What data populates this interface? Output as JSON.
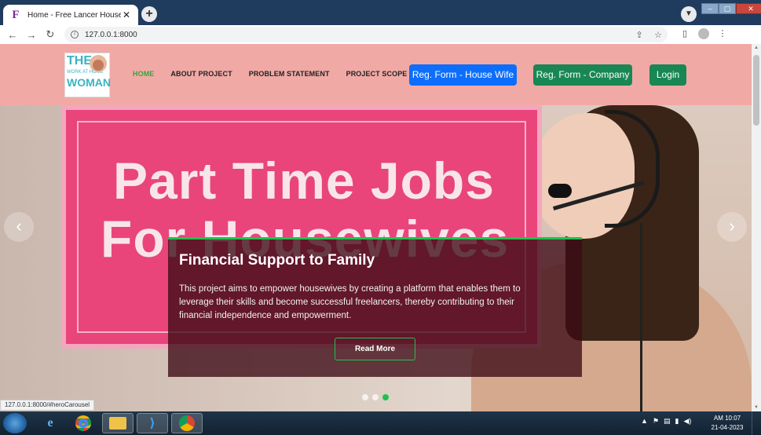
{
  "browser": {
    "tab_title": "Home - Free Lancer House Wife",
    "tab_favicon": "F",
    "url": "127.0.0.1:8000",
    "status_url": "127.0.0.1:8000/#heroCarousel"
  },
  "site": {
    "logo": {
      "line1": "THE",
      "line2": "WORK AT HOME",
      "line3": "WOMAN"
    },
    "menu": [
      {
        "label": "HOME",
        "active": true
      },
      {
        "label": "ABOUT PROJECT",
        "active": false
      },
      {
        "label": "PROBLEM STATEMENT",
        "active": false
      },
      {
        "label": "PROJECT SCOPE",
        "active": false
      }
    ],
    "buttons": {
      "reg_housewife": "Reg. Form - House Wife",
      "reg_company": "Reg. Form - Company",
      "login": "Login"
    },
    "colors": {
      "header_bg": "#f1a9a6",
      "active_menu": "#3aa33f",
      "primary": "#0d6efd",
      "success": "#198754",
      "accent": "#20c150"
    }
  },
  "hero": {
    "banner_line1": "Part Time Jobs",
    "banner_line2": "For Housewives",
    "caption_title": "Financial Support to Family",
    "caption_text": "This project aims to empower housewives by creating a platform that enables them to leverage their skills and become successful freelancers, thereby contributing to their financial independence and empowerment.",
    "read_more": "Read More",
    "slides": 3,
    "active_slide": 3,
    "prev_icon": "chevron-left-icon",
    "next_icon": "chevron-right-icon"
  },
  "taskbar": {
    "time": "AM 10:07",
    "date": "21-04-2023"
  }
}
